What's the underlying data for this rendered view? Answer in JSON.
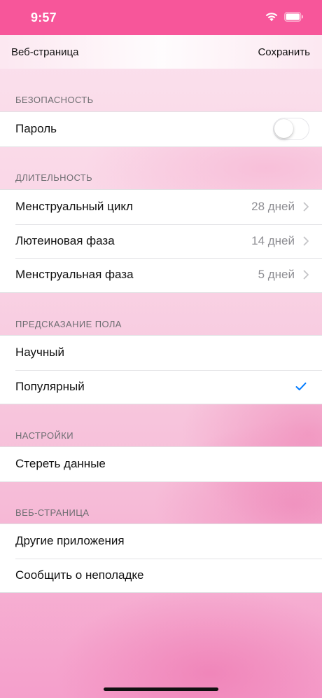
{
  "status": {
    "time": "9:57"
  },
  "nav": {
    "back_label": "Веб-страница",
    "save_label": "Сохранить"
  },
  "sections": {
    "security": {
      "header": "БЕЗОПАСНОСТЬ",
      "password_label": "Пароль",
      "password_enabled": false
    },
    "duration": {
      "header": "ДЛИТЕЛЬНОСТЬ",
      "items": [
        {
          "label": "Менструальный цикл",
          "value": "28 дней"
        },
        {
          "label": "Лютеиновая фаза",
          "value": "14 дней"
        },
        {
          "label": "Менструальная фаза",
          "value": "5 дней"
        }
      ]
    },
    "gender_prediction": {
      "header": "ПРЕДСКАЗАНИЕ ПОЛА",
      "items": [
        {
          "label": "Научный",
          "selected": false
        },
        {
          "label": "Популярный",
          "selected": true
        }
      ]
    },
    "settings": {
      "header": "НАСТРОЙКИ",
      "items": [
        {
          "label": "Стереть данные"
        }
      ]
    },
    "webpage": {
      "header": "ВЕБ-СТРАНИЦА",
      "items": [
        {
          "label": "Другие приложения"
        },
        {
          "label": "Сообщить о неполадке"
        }
      ]
    }
  },
  "colors": {
    "status_bar": "#f7569a",
    "checkmark": "#007aff",
    "background_pink": "#f6bdd8"
  }
}
